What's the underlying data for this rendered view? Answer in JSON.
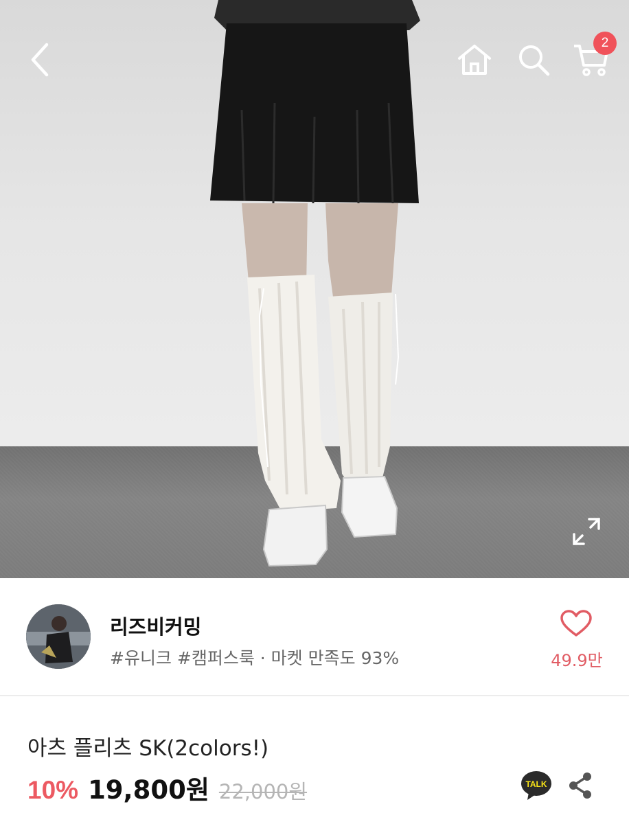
{
  "header": {
    "back_icon": "chevron-left-icon",
    "home_icon": "home-icon",
    "search_icon": "search-icon",
    "cart_icon": "cart-icon",
    "cart_count": "2",
    "badge_color": "#f0525a"
  },
  "hero": {
    "expand_icon": "expand-icon"
  },
  "shop": {
    "name": "리즈비커밍",
    "tags": "#유니크 #캠퍼스룩 · 마켓 만족도 93%",
    "like_icon": "heart-outline-icon",
    "like_count": "49.9만",
    "accent_color": "#e15c64"
  },
  "product": {
    "title": "아츠 플리츠 SK(2colors!)",
    "discount": "10%",
    "price": "19,800원",
    "original_price": "22,000원",
    "talk_label": "TALK",
    "share_icon": "share-icon"
  }
}
